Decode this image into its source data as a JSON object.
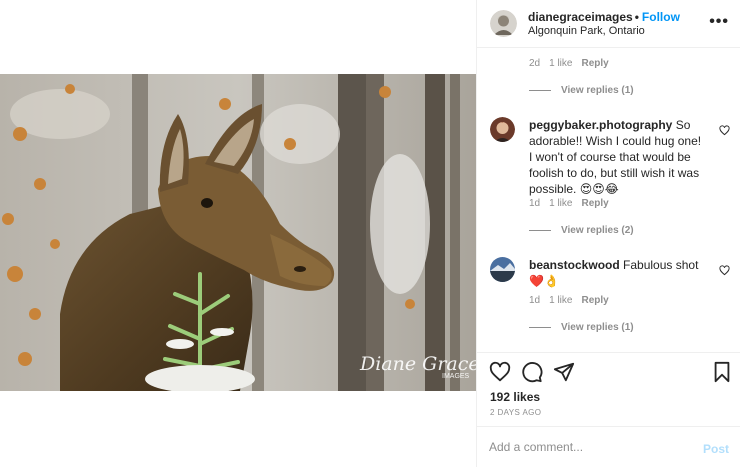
{
  "post": {
    "username": "dianegraceimages",
    "follow_label": "Follow",
    "separator": "•",
    "location": "Algonquin Park, Ontario",
    "more_icon": "more-horizontal-icon",
    "watermark_line1": "Diane Grace",
    "watermark_line2": "IMAGES"
  },
  "first_comment_meta": {
    "time": "2d",
    "likes": "1 like",
    "reply": "Reply",
    "view_replies": "View replies (1)"
  },
  "comments": [
    {
      "username": "peggybaker.photography",
      "text": "So adorable!! Wish I could hug one! I won't of course that would be foolish to do, but still wish it was possible. 😍😍😂",
      "time": "1d",
      "likes": "1 like",
      "reply": "Reply",
      "view_replies": "View replies (2)"
    },
    {
      "username": "beanstockwood",
      "text": "Fabulous shot ❤️👌",
      "time": "1d",
      "likes": "1 like",
      "reply": "Reply",
      "view_replies": "View replies (1)"
    }
  ],
  "actions": {
    "likes": "192 likes",
    "posted": "2 DAYS AGO",
    "icons": [
      "heart-icon",
      "comment-icon",
      "share-icon",
      "bookmark-icon"
    ]
  },
  "add_comment": {
    "placeholder": "Add a comment...",
    "post_label": "Post"
  },
  "colors": {
    "link_blue": "#0095f6",
    "post_disabled": "#b2dffc",
    "muted": "#8e8e8e"
  }
}
